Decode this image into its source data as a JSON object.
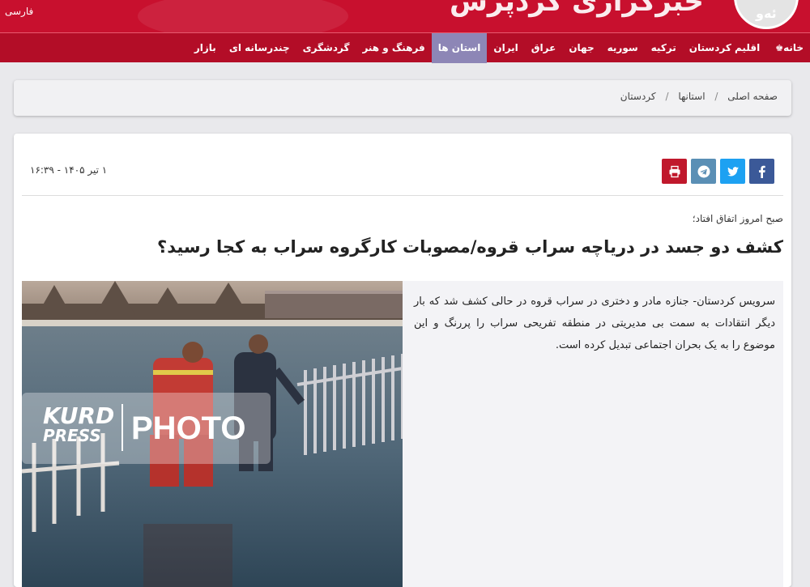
{
  "header": {
    "lang_label": "فارسی",
    "logo_text": "خبرگزاری کردپرس",
    "logo_mark": "ئەو"
  },
  "nav": {
    "items": [
      {
        "label": "خانه",
        "active": false
      },
      {
        "label": "اقلیم کردستان",
        "active": false
      },
      {
        "label": "ترکیه",
        "active": false
      },
      {
        "label": "سوریه",
        "active": false
      },
      {
        "label": "جهان",
        "active": false
      },
      {
        "label": "عراق",
        "active": false
      },
      {
        "label": "ایران",
        "active": false
      },
      {
        "label": "استان ها",
        "active": true
      },
      {
        "label": "فرهنگ و هنر",
        "active": false
      },
      {
        "label": "گردشگری",
        "active": false
      },
      {
        "label": "چندرسانه ای",
        "active": false
      },
      {
        "label": "بازار",
        "active": false
      }
    ]
  },
  "breadcrumb": {
    "home": "صفحه اصلی",
    "section": "استانها",
    "current": "کردستان",
    "separator": "/"
  },
  "article": {
    "date": "۱ تیر ۱۴۰۵ - ۱۶:۳۹",
    "kicker": "صبح امروز اتفاق افتاد؛",
    "title": "کشف دو جسد در دریاچه سراب قروه/مصوبات کارگروه سراب به کجا رسید؟",
    "lead": "سرویس کردستان- جنازه مادر و دختری در سراب قروه در حالی کشف شد که بار دیگر انتقادات به سمت بی مدیریتی در منطقه تفریحی سراب را پررنگ و این موضوع را به یک بحران اجتماعی تبدیل کرده است.",
    "photo_watermark_brand_top": "KURD",
    "photo_watermark_brand_bottom": "PRESS",
    "photo_watermark_label": "PHOTO"
  },
  "share": {
    "buttons": [
      {
        "name": "facebook",
        "icon": "facebook-icon",
        "color": "#3b5998"
      },
      {
        "name": "twitter",
        "icon": "twitter-icon",
        "color": "#1da1f2"
      },
      {
        "name": "telegram",
        "icon": "telegram-icon",
        "color": "#5a8fb5"
      },
      {
        "name": "print",
        "icon": "print-icon",
        "color": "#c0182c"
      }
    ]
  },
  "colors": {
    "brand_red": "#c8102e",
    "nav_red": "#b30d27",
    "nav_active": "#8d86b6"
  }
}
